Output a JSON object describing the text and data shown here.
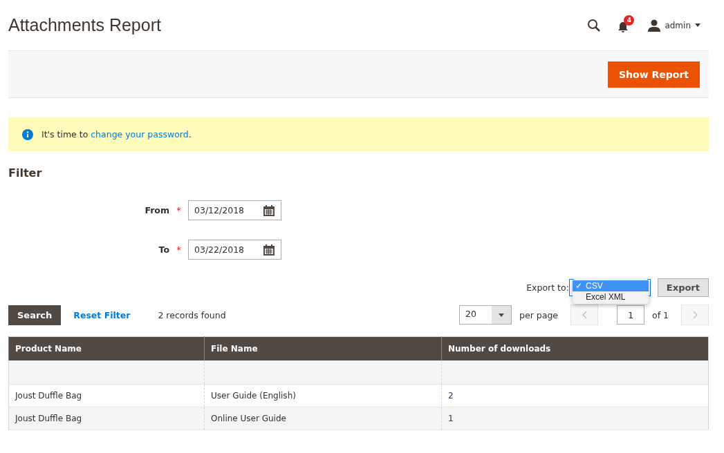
{
  "header": {
    "title": "Attachments Report",
    "notifications": "4",
    "user": "admin"
  },
  "actions": {
    "primary": "Show Report"
  },
  "message": {
    "before": "It's time to ",
    "link": "change your password",
    "after": "."
  },
  "filter": {
    "title": "Filter",
    "fields": [
      {
        "label": "From",
        "required": "*",
        "value": "03/12/2018"
      },
      {
        "label": "To",
        "required": "*",
        "value": "03/22/2018"
      }
    ]
  },
  "export": {
    "label": "Export to:",
    "check": "✓",
    "options": [
      {
        "label": "CSV",
        "selected": true
      },
      {
        "label": "Excel XML",
        "selected": false
      }
    ],
    "button": "Export"
  },
  "toolbar": {
    "search": "Search",
    "reset": "Reset Filter",
    "count": "2 records found",
    "per_page_value": "20",
    "per_page_label": "per page",
    "page": "1",
    "of": "of 1"
  },
  "table": {
    "columns": [
      "Product Name",
      "File Name",
      "Number of downloads"
    ],
    "rows": [
      [
        "Joust Duffle Bag",
        "User Guide (English)",
        "2"
      ],
      [
        "Joust Duffle Bag",
        "Online User Guide",
        "1"
      ]
    ]
  }
}
